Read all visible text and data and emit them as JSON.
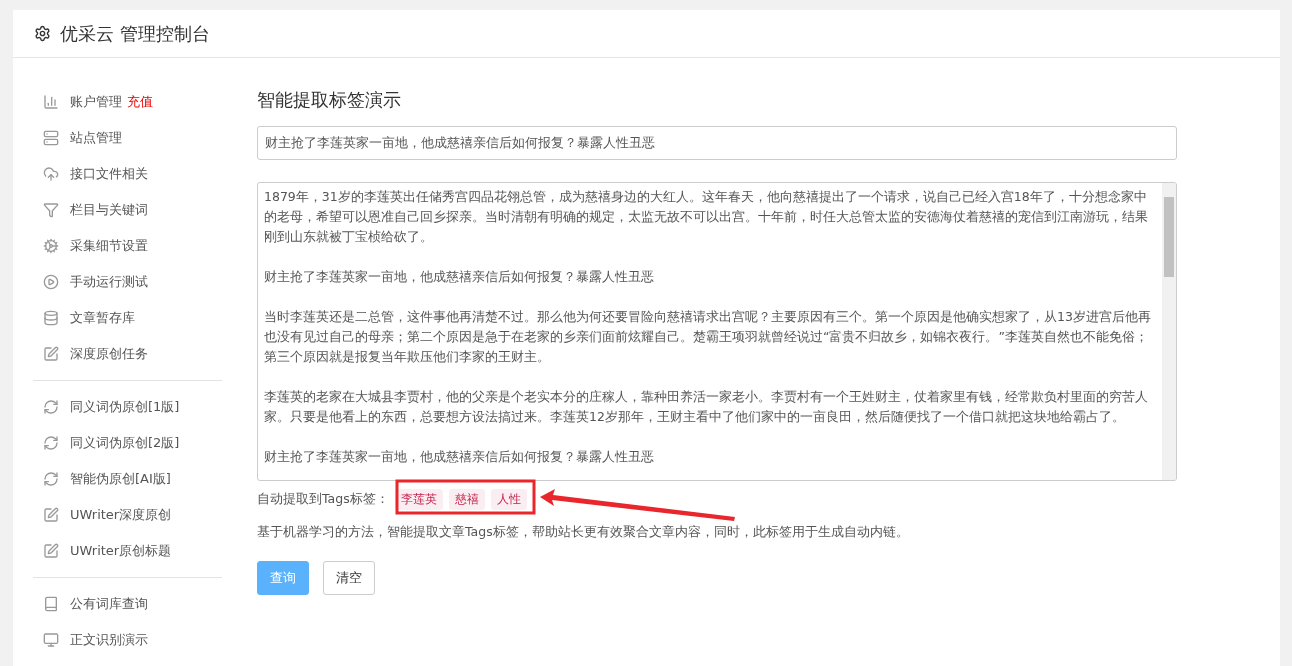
{
  "header": {
    "title": "优采云 管理控制台"
  },
  "sidebar": {
    "groups": [
      {
        "items": [
          {
            "label": "账户管理",
            "badge": "充值",
            "selected": false
          },
          {
            "label": "站点管理",
            "selected": false
          },
          {
            "label": "接口文件相关",
            "selected": false
          },
          {
            "label": "栏目与关键词",
            "selected": false
          },
          {
            "label": "采集细节设置",
            "selected": false
          },
          {
            "label": "手动运行测试",
            "selected": false
          },
          {
            "label": "文章暂存库",
            "selected": false
          },
          {
            "label": "深度原创任务",
            "selected": false
          }
        ]
      },
      {
        "items": [
          {
            "label": "同义词伪原创[1版]",
            "selected": false
          },
          {
            "label": "同义词伪原创[2版]",
            "selected": false
          },
          {
            "label": "智能伪原创[AI版]",
            "selected": false
          },
          {
            "label": "UWriter深度原创",
            "selected": false
          },
          {
            "label": "UWriter原创标题",
            "selected": false
          }
        ]
      },
      {
        "items": [
          {
            "label": "公有词库查询",
            "selected": false
          },
          {
            "label": "正文识别演示",
            "selected": false
          }
        ]
      }
    ]
  },
  "main": {
    "heading": "智能提取标签演示",
    "title_field": {
      "value": "财主抢了李莲英家一亩地，他成慈禧亲信后如何报复？暴露人性丑恶"
    },
    "body_field": {
      "paragraphs": [
        "1879年，31岁的李莲英出任储秀宫四品花翎总管，成为慈禧身边的大红人。这年春天，他向慈禧提出了一个请求，说自己已经入宫18年了，十分想念家中的老母，希望可以恩准自己回乡探亲。当时清朝有明确的规定，太监无故不可以出宫。十年前，时任大总管太监的安德海仗着慈禧的宠信到江南游玩，结果刚到山东就被丁宝桢给砍了。",
        "财主抢了李莲英家一亩地，他成慈禧亲信后如何报复？暴露人性丑恶",
        "当时李莲英还是二总管，这件事他再清楚不过。那么他为何还要冒险向慈禧请求出宫呢？主要原因有三个。第一个原因是他确实想家了，从13岁进宫后他再也没有见过自己的母亲；第二个原因是急于在老家的乡亲们面前炫耀自己。楚霸王项羽就曾经说过“富贵不归故乡，如锦衣夜行。”李莲英自然也不能免俗；第三个原因就是报复当年欺压他们李家的王财主。",
        "李莲英的老家在大城县李贾村，他的父亲是个老实本分的庄稼人，靠种田养活一家老小。李贾村有一个王姓财主，仗着家里有钱，经常欺负村里面的穷苦人家。只要是他看上的东西，总要想方设法搞过来。李莲英12岁那年，王财主看中了他们家中的一亩良田，然后随便找了一个借口就把这块地给霸占了。",
        "财主抢了李莲英家一亩地，他成慈禧亲信后如何报复？暴露人性丑恶"
      ]
    },
    "tags_label": "自动提取到Tags标签：",
    "tags": [
      "李莲英",
      "慈禧",
      "人性"
    ],
    "description": "基于机器学习的方法，智能提取文章Tags标签，帮助站长更有效聚合文章内容，同时，此标签用于生成自动内链。",
    "buttons": [
      {
        "label": "查询",
        "kind": "primary"
      },
      {
        "label": "清空",
        "kind": "default"
      }
    ]
  }
}
